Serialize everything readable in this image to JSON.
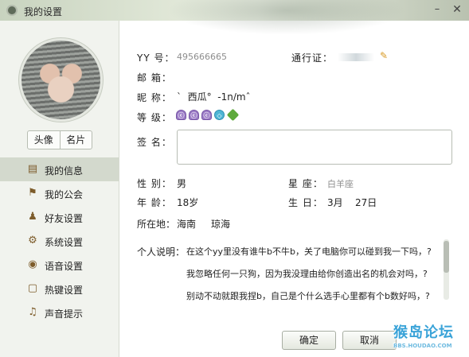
{
  "window": {
    "title": "我的设置",
    "minimize_label": "–",
    "close_label": "✕"
  },
  "sidebar": {
    "avatar_buttons": [
      "头像",
      "名片"
    ],
    "items": [
      {
        "label": "我的信息",
        "icon": "my-info-icon",
        "glyph": "▤"
      },
      {
        "label": "我的公会",
        "icon": "guild-flag-icon",
        "glyph": "⚑"
      },
      {
        "label": "好友设置",
        "icon": "friends-icon",
        "glyph": "♟"
      },
      {
        "label": "系统设置",
        "icon": "gear-icon",
        "glyph": "⚙"
      },
      {
        "label": "语音设置",
        "icon": "voice-icon",
        "glyph": "◉"
      },
      {
        "label": "热键设置",
        "icon": "hotkey-icon",
        "glyph": "▢"
      },
      {
        "label": "声音提示",
        "icon": "music-note-icon",
        "glyph": "♫"
      }
    ],
    "active_index": 0
  },
  "profile": {
    "yy_label": "YY 号：",
    "yy_value": "495666665",
    "passport_label": "通行证：",
    "email_label": "邮  箱：",
    "email_value": "",
    "nickname_label": "昵  称：",
    "nickname_value": "`  西瓜°  -1n/mˆ",
    "level_label": "等  级：",
    "level_icons": [
      "crown-badge-icon",
      "crown-badge-icon",
      "crown-badge-icon",
      "blue-diamond-icon",
      "green-leaf-icon"
    ],
    "signature_label": "签  名：",
    "signature_value": "",
    "gender_label": "性  别：",
    "gender_value": "男",
    "zodiac_label": "星  座：",
    "zodiac_value": "白羊座",
    "age_label": "年  龄：",
    "age_value": "18岁",
    "birthday_label": "生  日：",
    "birthday_month": "3月",
    "birthday_day": "27日",
    "location_label": "所在地：",
    "location_province": "海南",
    "location_city": "琼海",
    "description_label": "个人说明：",
    "description_lines": [
      "在这个yy里没有谁牛b不牛b，关了电脑你可以碰到我一下吗，?",
      "我忽略任何一只狗，因为我没理由给你创造出名的机会对吗，?",
      "别动不动就跟我捏b，自己是个什么选手心里都有个b数好吗，?"
    ]
  },
  "buttons": {
    "ok": "确定",
    "cancel": "取消"
  },
  "watermark": {
    "text": "猴岛论坛",
    "url": "BBS.HOUDAO.COM"
  },
  "colors": {
    "accent_link": "#8d8d8d",
    "active_nav": "#d3d9cd",
    "watermark": "#3aa3d8"
  }
}
